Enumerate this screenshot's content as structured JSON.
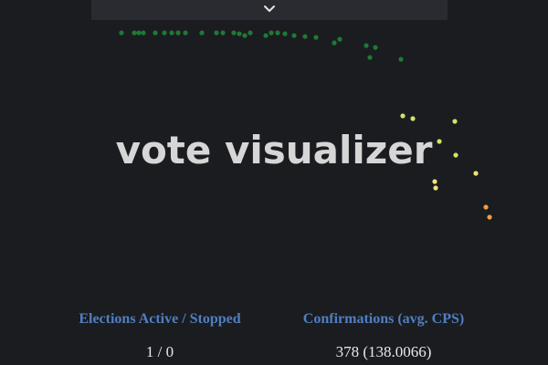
{
  "app": {
    "title": "vote visualizer"
  },
  "colors": {
    "background": "#1b1c20",
    "top_bar": "#2a2b30",
    "label_blue": "#4f7fc0",
    "value_text": "#e8e8e8",
    "title_text": "#d6d6d6",
    "dot_green": "#1d7a35",
    "dot_yellow_green": "#c9e86a",
    "dot_yellow": "#f2e27a",
    "dot_orange": "#f0a040"
  },
  "header": {
    "toggle_icon": "chevron-down-icon"
  },
  "stats": {
    "elections_label": "Elections Active / Stopped",
    "elections_value": "1 / 0",
    "confirmations_label": "Confirmations (avg. CPS)",
    "confirmations_value": "378 (138.0066)"
  }
}
